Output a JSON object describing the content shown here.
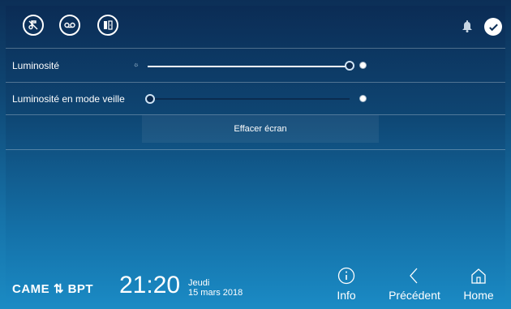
{
  "rows": {
    "brightness_label": "Luminosité",
    "brightness_value": 0.94,
    "standby_label": "Luminosité en mode veille",
    "standby_value": 0.0,
    "clear_label": "Effacer écran"
  },
  "footer": {
    "brand": "CAME ⇅ BPT",
    "time": "21:20",
    "day": "Jeudi",
    "date": "15 mars 2018",
    "info_label": "Info",
    "back_label": "Précédent",
    "home_label": "Home"
  },
  "icons": {
    "top_left": [
      "music-mute-icon",
      "voicemail-icon",
      "door-icon"
    ],
    "top_right": [
      "bell-icon",
      "check-icon"
    ],
    "nav": [
      "info-icon",
      "chevron-left-icon",
      "home-icon"
    ]
  }
}
